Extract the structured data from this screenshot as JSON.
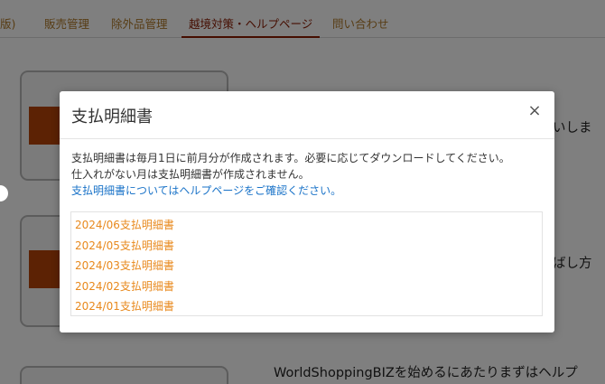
{
  "nav": {
    "items": [
      {
        "label": "版)"
      },
      {
        "label": "販売管理"
      },
      {
        "label": "除外品管理"
      },
      {
        "label": "越境対策・ヘルプページ"
      },
      {
        "label": "問い合わせ"
      }
    ],
    "active_index": 3
  },
  "background": {
    "texts": [
      "いしま",
      "ばし方",
      "WorldShoppingBIZを始めるにあたりまずはヘルプ"
    ]
  },
  "modal": {
    "title": "支払明細書",
    "close_label": "×",
    "description_lines": [
      "支払明細書は毎月1日に前月分が作成されます。必要に応じてダウンロードしてください。",
      "仕入れがない月は支払明細書が作成されません。"
    ],
    "help_link": "支払明細書についてはヘルプページをご確認ください。",
    "statements": [
      {
        "label": "2024/06支払明細書"
      },
      {
        "label": "2024/05支払明細書"
      },
      {
        "label": "2024/03支払明細書"
      },
      {
        "label": "2024/02支払明細書"
      },
      {
        "label": "2024/01支払明細書"
      }
    ]
  },
  "colors": {
    "accent": "#8a1a00",
    "nav_text": "#b07a2a",
    "statement_link": "#e8891d",
    "help_link": "#1a73c8"
  }
}
